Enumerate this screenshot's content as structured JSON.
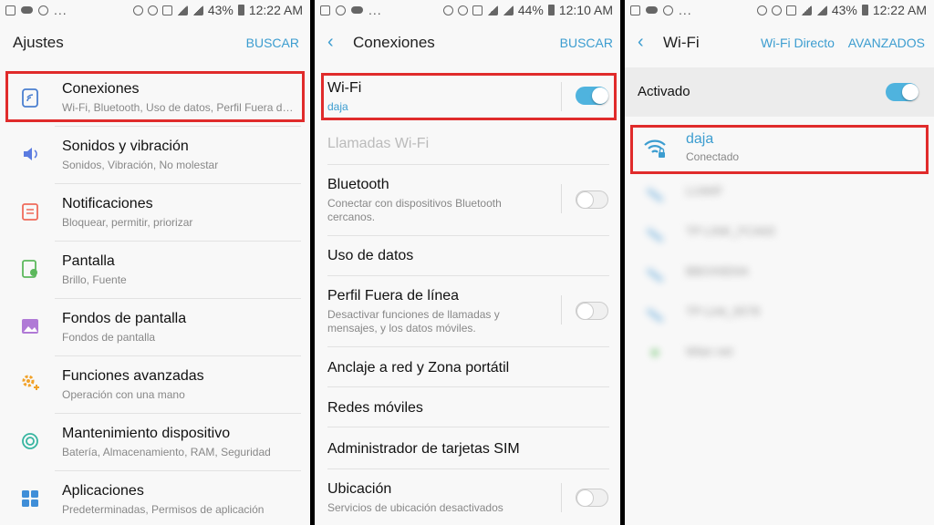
{
  "panel1": {
    "status": {
      "battery": "43%",
      "time": "12:22 AM"
    },
    "title": "Ajustes",
    "action": "BUSCAR",
    "items": [
      {
        "title": "Conexiones",
        "subtitle": "Wi-Fi, Bluetooth, Uso de datos, Perfil Fuera de línea",
        "icon": "wifi-connections-icon",
        "color": "#4a7fd0"
      },
      {
        "title": "Sonidos y vibración",
        "subtitle": "Sonidos, Vibración, No molestar",
        "icon": "speaker-icon",
        "color": "#5b7be0"
      },
      {
        "title": "Notificaciones",
        "subtitle": "Bloquear, permitir, priorizar",
        "icon": "notification-icon",
        "color": "#ef6b5b"
      },
      {
        "title": "Pantalla",
        "subtitle": "Brillo, Fuente",
        "icon": "display-icon",
        "color": "#5cb85c"
      },
      {
        "title": "Fondos de pantalla",
        "subtitle": "Fondos de pantalla",
        "icon": "wallpaper-icon",
        "color": "#b07ad6"
      },
      {
        "title": "Funciones avanzadas",
        "subtitle": "Operación con una mano",
        "icon": "gear-plus-icon",
        "color": "#f1a22a"
      },
      {
        "title": "Mantenimiento dispositivo",
        "subtitle": "Batería, Almacenamiento, RAM, Seguridad",
        "icon": "maintenance-icon",
        "color": "#36b5a0"
      },
      {
        "title": "Aplicaciones",
        "subtitle": "Predeterminadas, Permisos de aplicación",
        "icon": "apps-grid-icon",
        "color": "#3f8ed8"
      }
    ]
  },
  "panel2": {
    "status": {
      "battery": "44%",
      "time": "12:10 AM"
    },
    "title": "Conexiones",
    "action": "BUSCAR",
    "items": [
      {
        "title": "Wi-Fi",
        "subtitle": "daja",
        "toggle": "on"
      },
      {
        "title": "Llamadas Wi-Fi",
        "subtitle": "",
        "toggle": "none"
      },
      {
        "title": "Bluetooth",
        "subtitle": "Conectar con dispositivos Bluetooth cercanos.",
        "toggle": "off"
      },
      {
        "title": "Uso de datos",
        "subtitle": "",
        "toggle": "none"
      },
      {
        "title": "Perfil Fuera de línea",
        "subtitle": "Desactivar funciones de llamadas y mensajes, y los datos móviles.",
        "toggle": "off"
      },
      {
        "title": "Anclaje a red y Zona portátil",
        "subtitle": "",
        "toggle": "none"
      },
      {
        "title": "Redes móviles",
        "subtitle": "",
        "toggle": "none"
      },
      {
        "title": "Administrador de tarjetas SIM",
        "subtitle": "",
        "toggle": "none"
      },
      {
        "title": "Ubicación",
        "subtitle": "Servicios de ubicación desactivados",
        "toggle": "off"
      }
    ]
  },
  "panel3": {
    "status": {
      "battery": "43%",
      "time": "12:22 AM"
    },
    "title": "Wi-Fi",
    "action1": "Wi-Fi Directo",
    "action2": "AVANZADOS",
    "master": {
      "label": "Activado",
      "toggle": "on"
    },
    "connected": {
      "ssid": "daja",
      "status": "Conectado"
    },
    "networks": [
      {
        "ssid": "LUWIF"
      },
      {
        "ssid": "TP-LINK_FCA63"
      },
      {
        "ssid": "BBOX9D0A"
      },
      {
        "ssid": "TP-Link_6578"
      },
      {
        "ssid": "Wlan net"
      }
    ]
  },
  "colors": {
    "accent": "#3c9dd0",
    "toggle_on": "#4fb3de",
    "highlight": "#e02b2b"
  }
}
